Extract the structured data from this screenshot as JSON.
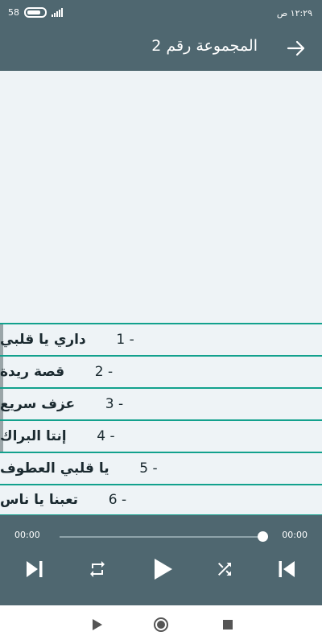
{
  "status_bar": {
    "battery": "58",
    "time": "١٢:٢٩ ص"
  },
  "app_bar": {
    "title": "المجموعة رقم 2",
    "back_icon": "arrow-right-icon"
  },
  "tracks": [
    {
      "num": "1 -",
      "name": "داري يا قلبي"
    },
    {
      "num": "2 -",
      "name": "قصة ريدة"
    },
    {
      "num": "3 -",
      "name": "عزف سريع"
    },
    {
      "num": "4 -",
      "name": "إنتا البراك"
    },
    {
      "num": "5 -",
      "name": "يا قلبي العطوف"
    },
    {
      "num": "6 -",
      "name": "تعبنا يا ناس"
    }
  ],
  "player": {
    "elapsed": "00:00",
    "duration": "00:00",
    "progress": 1.0,
    "controls": [
      "skip-next-icon",
      "repeat-icon",
      "play-icon",
      "shuffle-icon",
      "skip-previous-icon"
    ]
  },
  "nav_bar": {
    "icons": [
      "back-triangle-icon",
      "home-circle-icon",
      "recents-square-icon"
    ]
  },
  "colors": {
    "primary": "#4f6770",
    "accent": "#12a18d",
    "background": "#eef3f6"
  }
}
